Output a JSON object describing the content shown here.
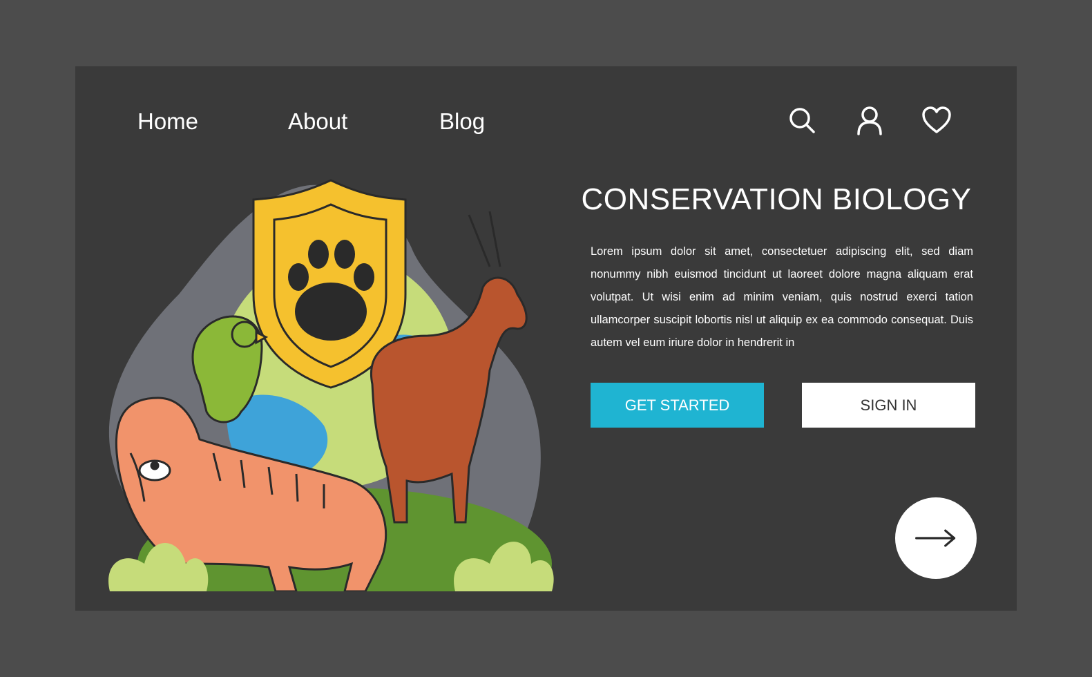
{
  "nav": {
    "home_label": "Home",
    "about_label": "About",
    "blog_label": "Blog",
    "icons": [
      "search-icon",
      "user-icon",
      "heart-icon"
    ]
  },
  "hero": {
    "title": "CONSERVATION BIOLOGY",
    "body": "Lorem ipsum dolor sit amet, consectetuer adipiscing elit, sed diam nonummy nibh euismod tincidunt ut laoreet dolore magna aliquam erat volutpat. Ut wisi enim ad minim veniam, quis nostrud exerci tation ullamcorper suscipit lobortis nisl ut aliquip ex ea commodo consequat. Duis autem vel eum iriure dolor in hendrerit in",
    "get_started_label": "GET STARTED",
    "sign_in_label": "SIGN IN",
    "next_icon": "arrow-right-icon"
  },
  "colors": {
    "page_bg": "#4c4c4c",
    "panel_bg": "#3a3a3a",
    "accent": "#1fb4d2",
    "shield": "#f5c12e",
    "tiger": "#f1936b",
    "parrot": "#8bb838",
    "antelope": "#b9552e"
  }
}
